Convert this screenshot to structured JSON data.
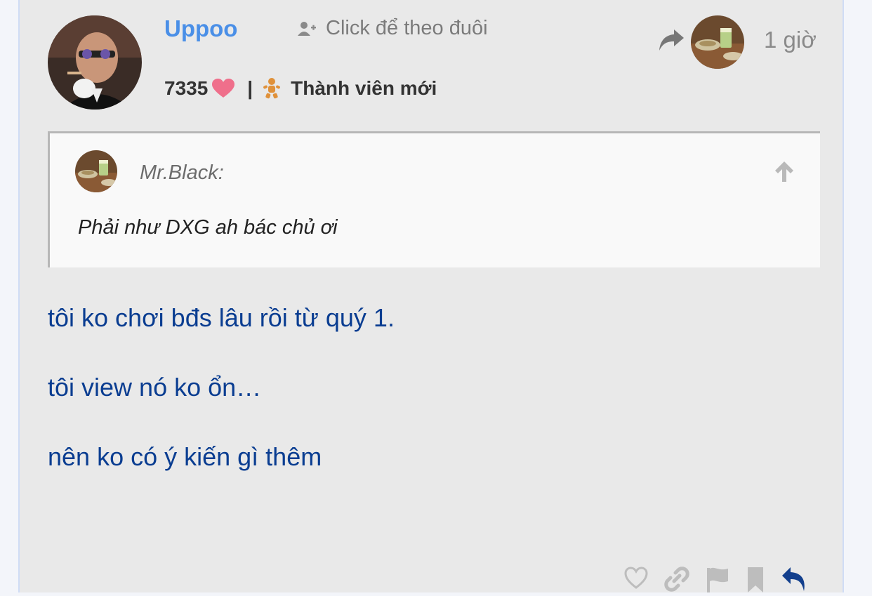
{
  "author": {
    "name": "Uppoo",
    "likes": "7335",
    "title": "Thành viên mới",
    "follow_label": "Click để theo đuôi"
  },
  "time_ago": "1 giờ",
  "quote": {
    "author": "Mr.Black:",
    "text": "Phải như DXG ah bác chủ ơi"
  },
  "body": [
    "tôi ko chơi bđs lâu rồi từ quý 1.",
    "tôi view nó ko ổn…",
    "nên ko có ý kiến gì thêm"
  ],
  "icons": {
    "follow": "user-plus-icon",
    "heart": "heart-icon",
    "title_badge": "baby-icon",
    "share": "share-arrow-icon",
    "quote_up": "arrow-up-icon",
    "like": "heart-outline-icon",
    "link": "link-icon",
    "flag": "flag-icon",
    "bookmark": "bookmark-icon",
    "reply": "reply-icon"
  },
  "colors": {
    "username": "#4a8fe7",
    "body_text": "#0a3d91",
    "heart": "#ef6f8b",
    "badge": "#e0913a",
    "reply_icon": "#123f8d",
    "muted_icon": "#bdbdbd"
  }
}
